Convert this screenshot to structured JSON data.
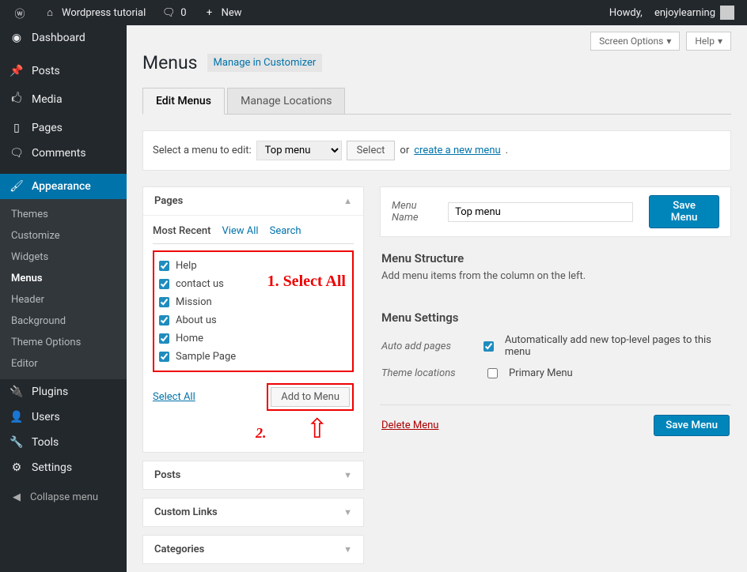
{
  "toolbar": {
    "site_name": "Wordpress tutorial",
    "comment_count": "0",
    "new_label": "New",
    "howdy_prefix": "Howdy,",
    "username": "enjoylearning"
  },
  "sidebar": {
    "items": [
      {
        "label": "Dashboard"
      },
      {
        "label": "Posts"
      },
      {
        "label": "Media"
      },
      {
        "label": "Pages"
      },
      {
        "label": "Comments"
      },
      {
        "label": "Appearance"
      },
      {
        "label": "Plugins"
      },
      {
        "label": "Users"
      },
      {
        "label": "Tools"
      },
      {
        "label": "Settings"
      }
    ],
    "appearance_sub": [
      "Themes",
      "Customize",
      "Widgets",
      "Menus",
      "Header",
      "Background",
      "Theme Options",
      "Editor"
    ],
    "collapse_label": "Collapse menu"
  },
  "top_actions": {
    "screen_options": "Screen Options",
    "help": "Help"
  },
  "page": {
    "title": "Menus",
    "customizer_link": "Manage in Customizer",
    "tabs": {
      "edit": "Edit Menus",
      "locations": "Manage Locations"
    }
  },
  "select_bar": {
    "prompt": "Select a menu to edit:",
    "selected": "Top menu",
    "select_btn": "Select",
    "or_text": "or",
    "create_link": "create a new menu"
  },
  "accordions": {
    "pages": {
      "title": "Pages",
      "subtabs": [
        "Most Recent",
        "View All",
        "Search"
      ],
      "items": [
        "Help",
        "contact us",
        "Mission",
        "About us",
        "Home",
        "Sample Page"
      ],
      "select_all": "Select All",
      "add_btn": "Add to Menu"
    },
    "posts_title": "Posts",
    "custom_links_title": "Custom Links",
    "categories_title": "Categories"
  },
  "annotations": {
    "one": "1. Select All",
    "two": "2."
  },
  "menu_editor": {
    "name_label": "Menu Name",
    "name_value": "Top menu",
    "save_btn": "Save Menu",
    "structure_title": "Menu Structure",
    "structure_desc": "Add menu items from the column on the left.",
    "settings_title": "Menu Settings",
    "auto_add_label": "Auto add pages",
    "auto_add_text": "Automatically add new top-level pages to this menu",
    "theme_loc_label": "Theme locations",
    "theme_loc_text": "Primary Menu",
    "delete_link": "Delete Menu"
  }
}
